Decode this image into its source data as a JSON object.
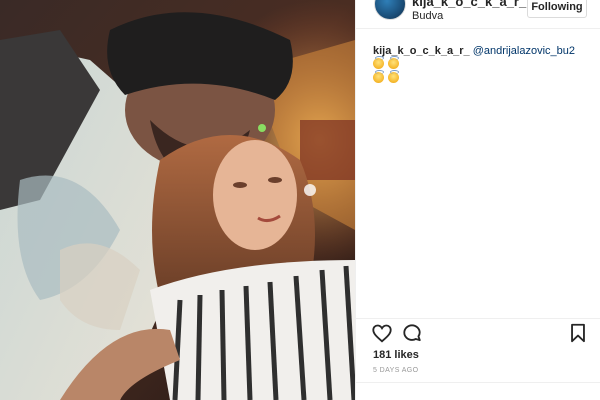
{
  "post": {
    "author": "kija_k_o_c_k_a_r_",
    "location": "Budva",
    "follow_label": "Following",
    "caption": {
      "user": "kija_k_o_c_k_a_r_",
      "mention": "@andrijalazovic_bu2",
      "emojis": [
        "smiling-face-with-halo",
        "smiling-face-with-halo",
        "smiling-face-with-halo",
        "smiling-face-with-halo"
      ]
    },
    "likes": "181 likes",
    "time_ago": "5 DAYS AGO"
  },
  "icons": {
    "like": "heart-icon",
    "comment": "comment-icon",
    "save": "bookmark-icon"
  },
  "colors": {
    "mention": "#003569",
    "text": "#262626",
    "muted": "#999999"
  }
}
